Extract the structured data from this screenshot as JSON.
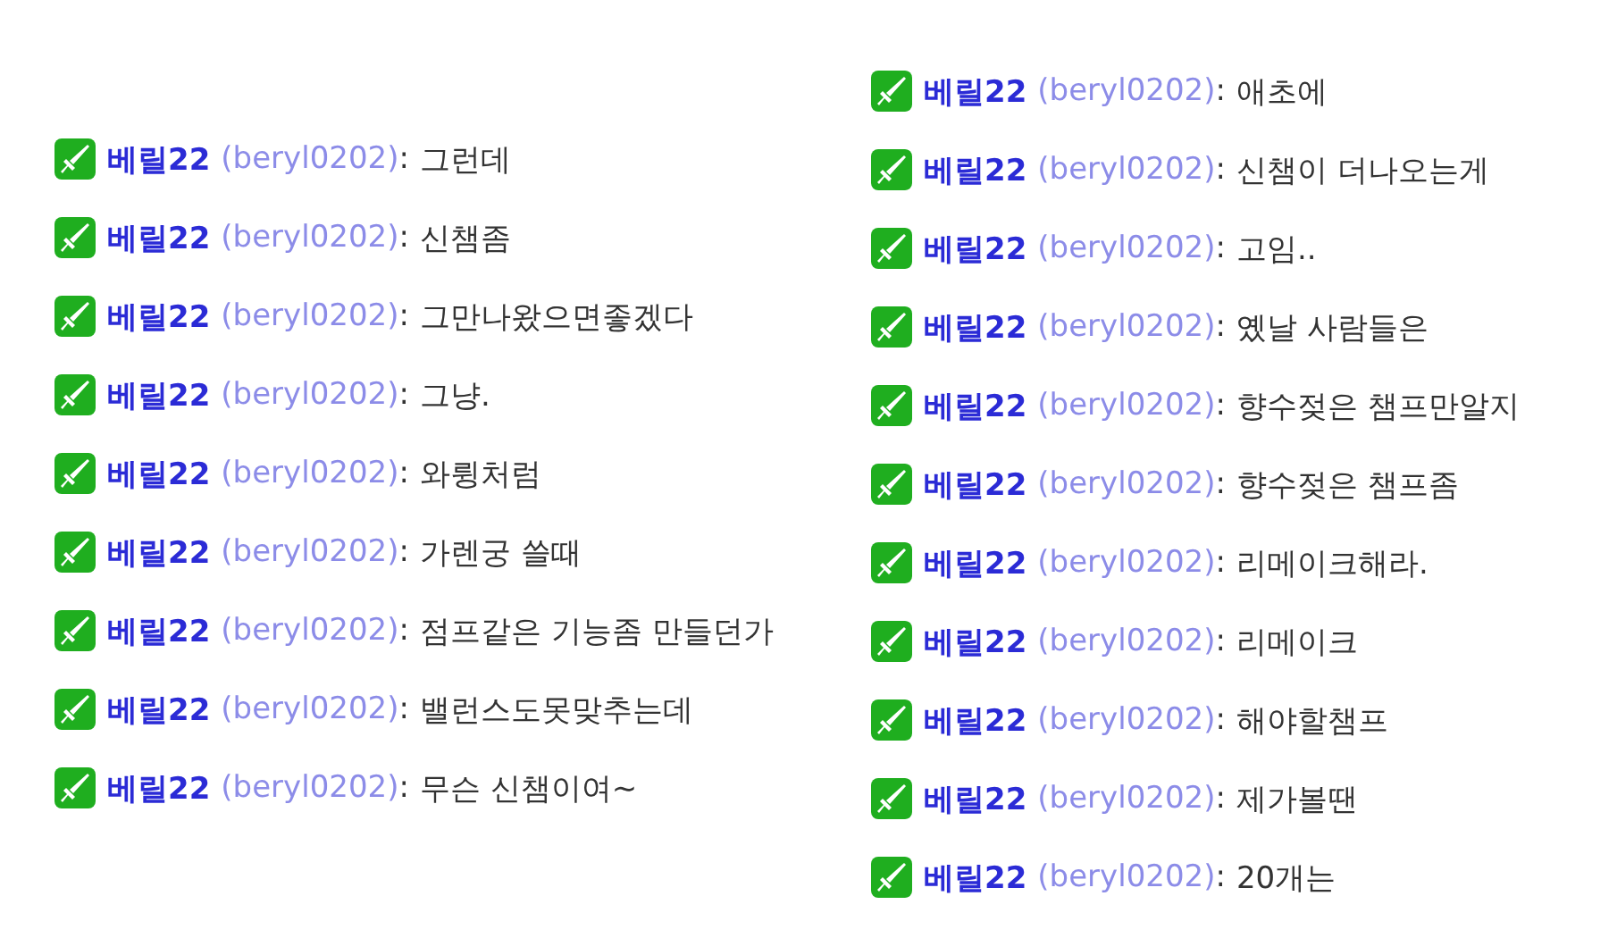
{
  "columns": [
    {
      "messages": [
        {
          "name": "베릴22",
          "handle": "(beryl0202)",
          "separator": ":",
          "text": "그런데"
        },
        {
          "name": "베릴22",
          "handle": "(beryl0202)",
          "separator": ":",
          "text": "신챔좀"
        },
        {
          "name": "베릴22",
          "handle": "(beryl0202)",
          "separator": ":",
          "text": "그만나왔으면좋겠다"
        },
        {
          "name": "베릴22",
          "handle": "(beryl0202)",
          "separator": ":",
          "text": "그냥."
        },
        {
          "name": "베릴22",
          "handle": "(beryl0202)",
          "separator": ":",
          "text": "와륑처럼"
        },
        {
          "name": "베릴22",
          "handle": "(beryl0202)",
          "separator": ":",
          "text": "가렌궁 쓸때"
        },
        {
          "name": "베릴22",
          "handle": "(beryl0202)",
          "separator": ":",
          "text": "점프같은 기능좀 만들던가"
        },
        {
          "name": "베릴22",
          "handle": "(beryl0202)",
          "separator": ":",
          "text": "밸런스도못맞추는데"
        },
        {
          "name": "베릴22",
          "handle": "(beryl0202)",
          "separator": ":",
          "text": "무슨 신챔이여~"
        }
      ]
    },
    {
      "messages": [
        {
          "name": "베릴22",
          "handle": "(beryl0202)",
          "separator": ":",
          "text": "애초에"
        },
        {
          "name": "베릴22",
          "handle": "(beryl0202)",
          "separator": ":",
          "text": "신챔이 더나오는게"
        },
        {
          "name": "베릴22",
          "handle": "(beryl0202)",
          "separator": ":",
          "text": "고임.."
        },
        {
          "name": "베릴22",
          "handle": "(beryl0202)",
          "separator": ":",
          "text": "옜날 사람들은"
        },
        {
          "name": "베릴22",
          "handle": "(beryl0202)",
          "separator": ":",
          "text": "향수젖은 챔프만알지"
        },
        {
          "name": "베릴22",
          "handle": "(beryl0202)",
          "separator": ":",
          "text": "향수젖은 챔프좀"
        },
        {
          "name": "베릴22",
          "handle": "(beryl0202)",
          "separator": ":",
          "text": "리메이크해라."
        },
        {
          "name": "베릴22",
          "handle": "(beryl0202)",
          "separator": ":",
          "text": "리메이크"
        },
        {
          "name": "베릴22",
          "handle": "(beryl0202)",
          "separator": ":",
          "text": "해야할챔프"
        },
        {
          "name": "베릴22",
          "handle": "(beryl0202)",
          "separator": ":",
          "text": "제가볼땐"
        },
        {
          "name": "베릴22",
          "handle": "(beryl0202)",
          "separator": ":",
          "text": "20개는"
        }
      ]
    }
  ]
}
